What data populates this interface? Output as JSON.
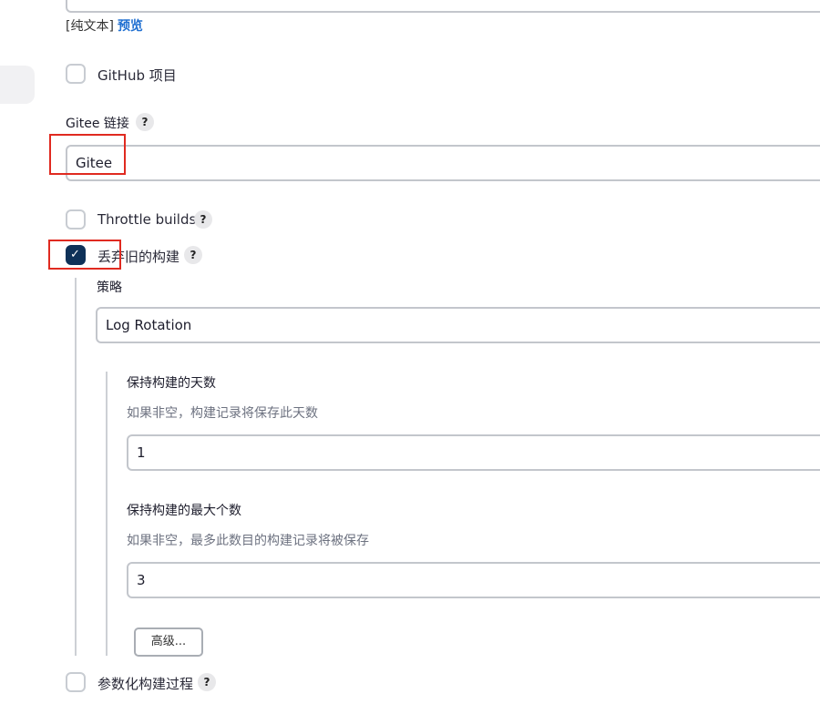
{
  "format": {
    "plain_text": "[纯文本]",
    "preview": "预览"
  },
  "github_project": {
    "label": "GitHub 项目",
    "checked": false
  },
  "gitee": {
    "label": "Gitee 链接",
    "help": "?",
    "value": "Gitee"
  },
  "throttle": {
    "label": "Throttle builds",
    "help": "?",
    "checked": false
  },
  "discard": {
    "label": "丢弃旧的构建",
    "help": "?",
    "checked": true,
    "checkmark": "✓"
  },
  "strategy": {
    "label": "策略",
    "value": "Log Rotation",
    "days": {
      "label": "保持构建的天数",
      "desc": "如果非空，构建记录将保存此天数",
      "value": "1"
    },
    "max": {
      "label": "保持构建的最大个数",
      "desc": "如果非空，最多此数目的构建记录将被保存",
      "value": "3"
    },
    "advanced": "高级..."
  },
  "parameterized": {
    "label": "参数化构建过程",
    "help": "?",
    "checked": false
  },
  "colors": {
    "highlight": "#e02a20",
    "checkbox_checked": "#0e3158",
    "link": "#1f6fd1"
  }
}
